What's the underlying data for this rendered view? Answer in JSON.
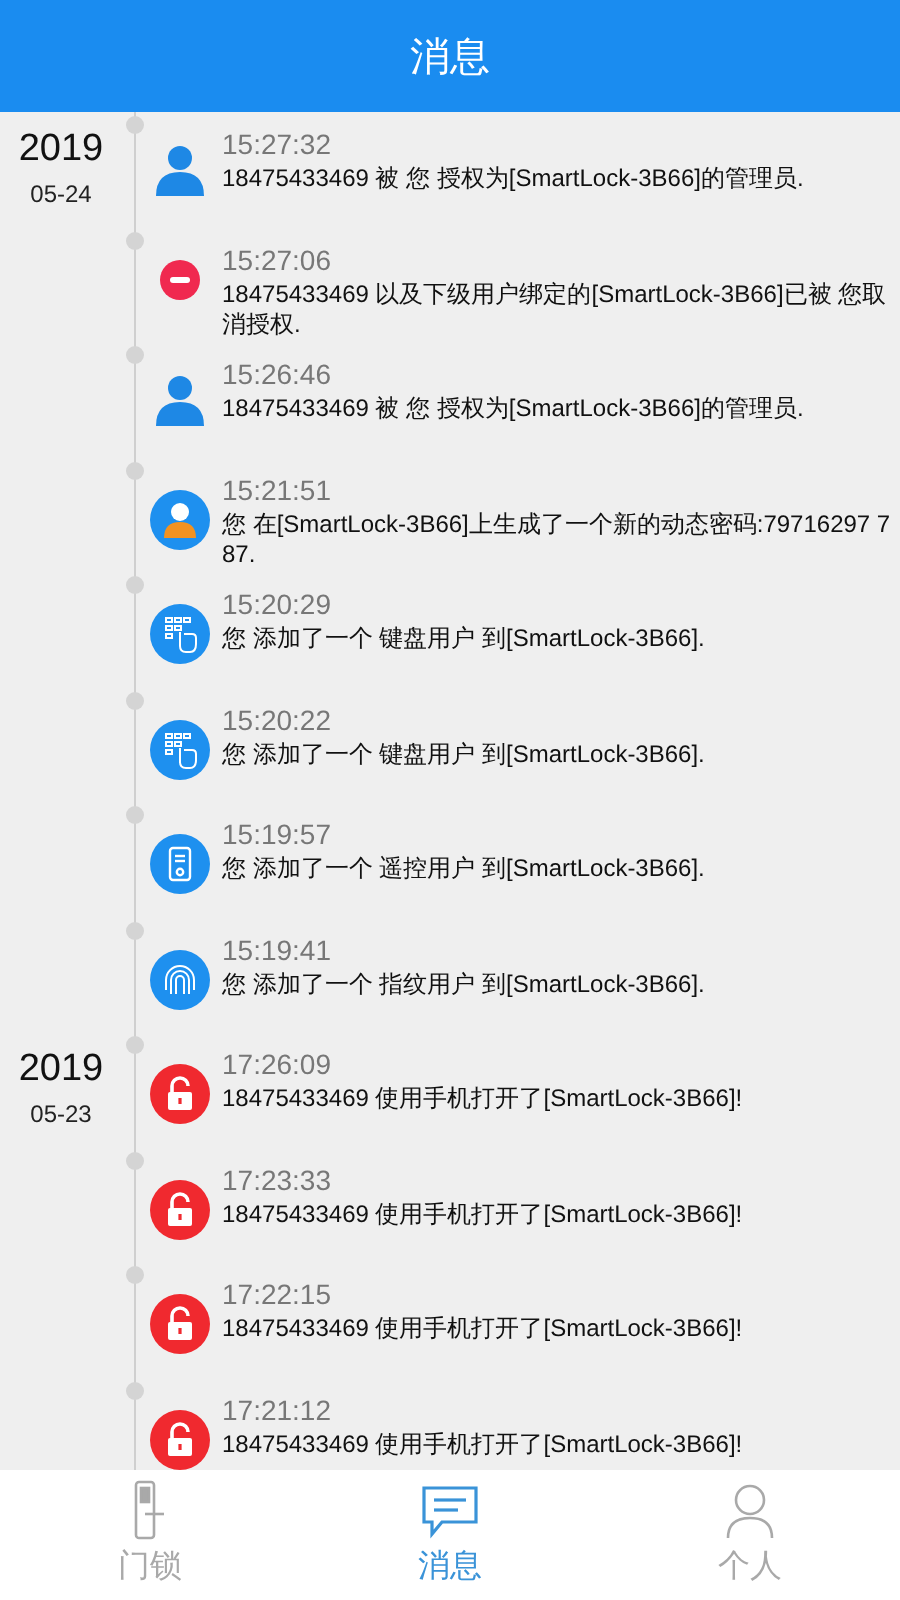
{
  "header": {
    "title": "消息"
  },
  "groups": [
    {
      "year": "2019",
      "day": "05-24",
      "messages": [
        {
          "kind": "user",
          "time": "15:27:32",
          "text": "18475433469 被 您 授权为[SmartLock-3B66]的管理员."
        },
        {
          "kind": "revoke",
          "time": "15:27:06",
          "text": "18475433469 以及下级用户绑定的[SmartLock-3B66]已被 您取消授权."
        },
        {
          "kind": "user",
          "time": "15:26:46",
          "text": "18475433469 被 您 授权为[SmartLock-3B66]的管理员."
        },
        {
          "kind": "avatar",
          "time": "15:21:51",
          "text": "您 在[SmartLock-3B66]上生成了一个新的动态密码:79716297 787."
        },
        {
          "kind": "keypad",
          "time": "15:20:29",
          "text": "您 添加了一个 键盘用户 到[SmartLock-3B66]."
        },
        {
          "kind": "keypad",
          "time": "15:20:22",
          "text": "您 添加了一个 键盘用户 到[SmartLock-3B66]."
        },
        {
          "kind": "remote",
          "time": "15:19:57",
          "text": "您 添加了一个 遥控用户 到[SmartLock-3B66]."
        },
        {
          "kind": "fingerprint",
          "time": "15:19:41",
          "text": "您 添加了一个 指纹用户 到[SmartLock-3B66]."
        }
      ]
    },
    {
      "year": "2019",
      "day": "05-23",
      "messages": [
        {
          "kind": "unlock",
          "time": "17:26:09",
          "text": "18475433469 使用手机打开了[SmartLock-3B66]!"
        },
        {
          "kind": "unlock",
          "time": "17:23:33",
          "text": "18475433469 使用手机打开了[SmartLock-3B66]!"
        },
        {
          "kind": "unlock",
          "time": "17:22:15",
          "text": "18475433469 使用手机打开了[SmartLock-3B66]!"
        },
        {
          "kind": "unlock",
          "time": "17:21:12",
          "text": "18475433469 使用手机打开了[SmartLock-3B66]!"
        }
      ]
    }
  ],
  "tabs": [
    {
      "kind": "lock",
      "label": "门锁",
      "selected": false
    },
    {
      "kind": "message",
      "label": "消息",
      "selected": true
    },
    {
      "kind": "person",
      "label": "个人",
      "selected": false
    }
  ]
}
